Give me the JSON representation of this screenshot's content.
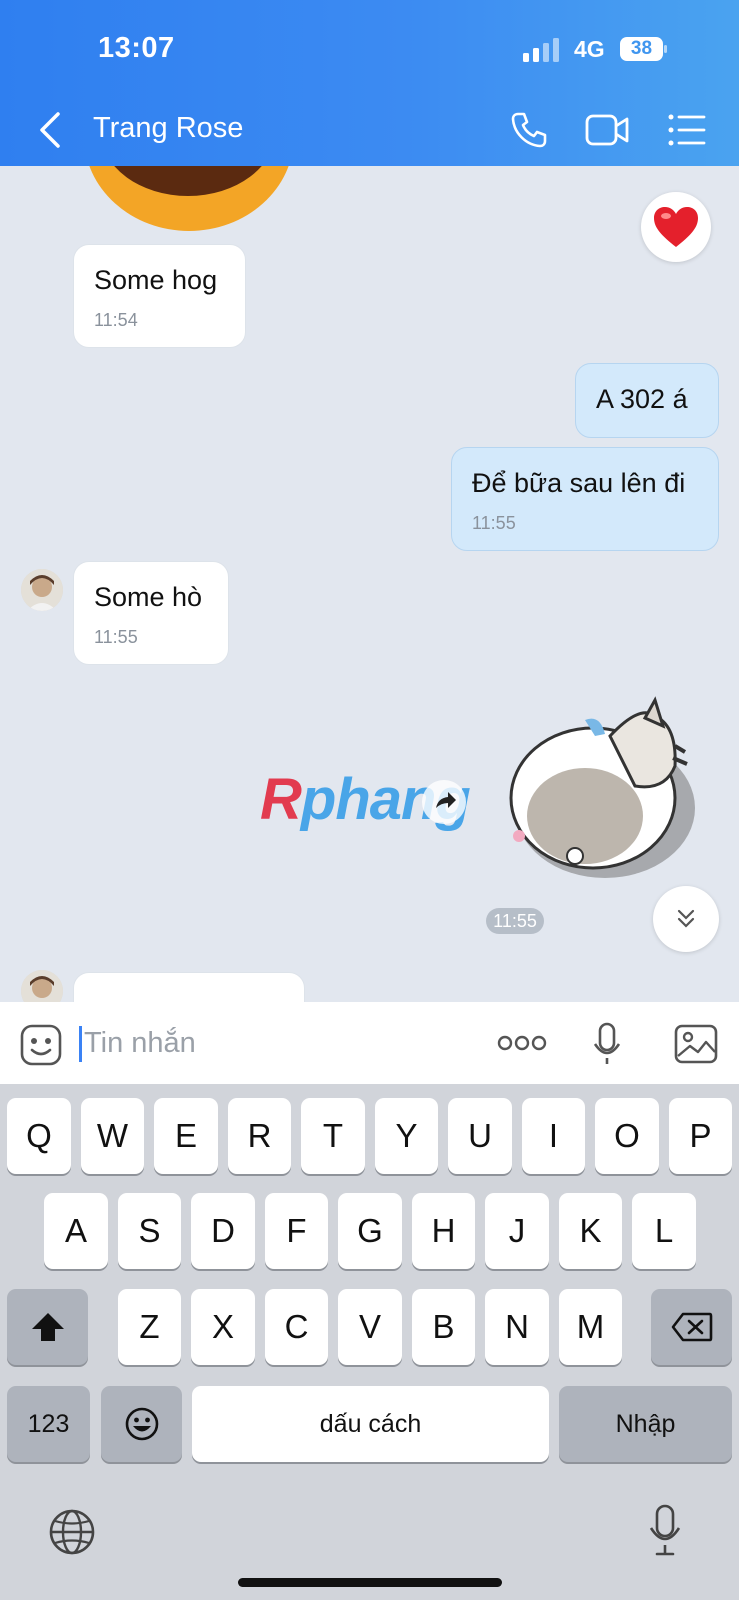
{
  "status_bar": {
    "time": "13:07",
    "network": "4G",
    "battery": "38"
  },
  "header": {
    "title": "Trang Rose",
    "back_icon": "chevron-left-icon",
    "call_icon": "phone-icon",
    "video_icon": "video-camera-icon",
    "menu_icon": "list-menu-icon"
  },
  "messages": [
    {
      "direction": "in",
      "text": "Some hog",
      "time": "11:54"
    },
    {
      "direction": "out",
      "text": "A 302 á"
    },
    {
      "direction": "out",
      "text": "Để bữa sau lên đi",
      "time": "11:55"
    },
    {
      "direction": "in",
      "text": "Some hò",
      "time": "11:55"
    },
    {
      "direction": "out",
      "type": "sticker",
      "time": "11:55"
    }
  ],
  "watermark": {
    "first": "R",
    "rest": "phang"
  },
  "composer": {
    "placeholder": "Tin nhắn",
    "value": ""
  },
  "keyboard": {
    "row1": [
      "Q",
      "W",
      "E",
      "R",
      "T",
      "Y",
      "U",
      "I",
      "O",
      "P"
    ],
    "row2": [
      "A",
      "S",
      "D",
      "F",
      "G",
      "H",
      "J",
      "K",
      "L"
    ],
    "row3": [
      "Z",
      "X",
      "C",
      "V",
      "B",
      "N",
      "M"
    ],
    "numbers": "123",
    "space": "dấu cách",
    "enter": "Nhập"
  },
  "colors": {
    "header_start": "#2f7ff0",
    "header_end": "#4aa3f0",
    "outgoing_bubble": "#d3e9fb",
    "incoming_bubble": "#ffffff",
    "accent": "#3a82f5"
  }
}
